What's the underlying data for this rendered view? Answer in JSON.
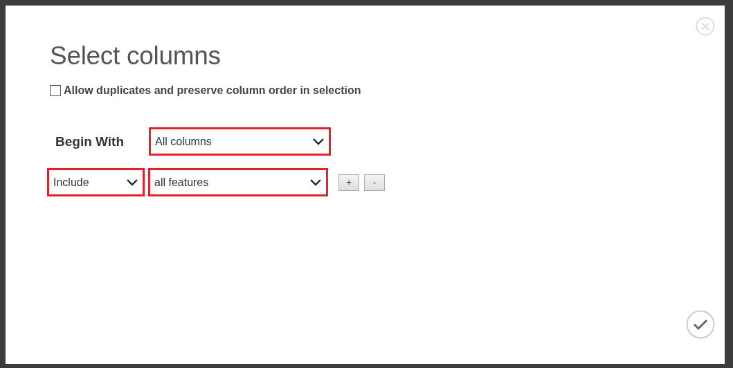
{
  "dialog": {
    "title": "Select columns"
  },
  "option": {
    "label": "Allow duplicates and preserve column order in selection",
    "checked": false
  },
  "begin_with": {
    "label": "Begin With",
    "value": "All columns"
  },
  "rules": [
    {
      "mode": "Include",
      "columns": "all features"
    }
  ],
  "rule_buttons": [
    "+",
    "-"
  ]
}
